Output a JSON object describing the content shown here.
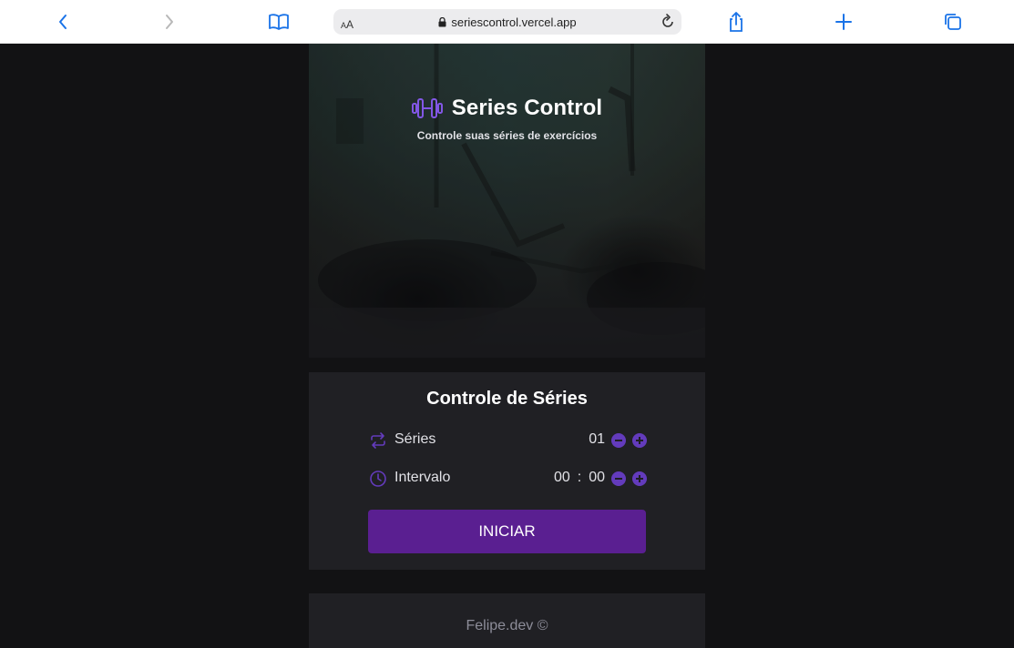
{
  "browser": {
    "url": "seriescontrol.vercel.app",
    "reader_label_small": "A",
    "reader_label_large": "A",
    "accent_color": "#1a73e8"
  },
  "header": {
    "title": "Series Control",
    "subtitle": "Controle suas séries de exercícios",
    "icon": "dumbbell-icon"
  },
  "panel": {
    "title": "Controle de Séries",
    "series": {
      "label": "Séries",
      "value": "01",
      "icon": "repeat-icon"
    },
    "interval": {
      "label": "Intervalo",
      "minutes": "00",
      "separator": ":",
      "seconds": "00",
      "icon": "clock-icon"
    },
    "start_label": "INICIAR"
  },
  "footer": {
    "credit": "Felipe.dev ©"
  },
  "colors": {
    "brand": "#633bbc",
    "button": "#5a1f91",
    "background": "#121214",
    "panel": "#202024"
  }
}
